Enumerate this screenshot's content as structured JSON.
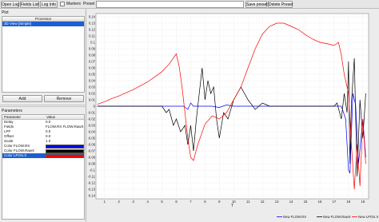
{
  "toolbar": {
    "open_log": "Open Log",
    "fields_list": "Fields List",
    "log_info": "Log Info",
    "markers_label": "Markers",
    "preset_label": "Preset",
    "save_preset": "Save preset",
    "delete_preset": "Delete Preset"
  },
  "plot_panel": {
    "title": "Plot",
    "table_header": "Processor",
    "selected_item": "3D View [Simple]",
    "add_button": "Add",
    "remove_button": "Remove"
  },
  "parameters_panel": {
    "title": "Parameters",
    "col_parameter": "Parameter",
    "col_value": "Value",
    "rows": [
      {
        "name": "Delay",
        "value": "0.0"
      },
      {
        "name": "Fields",
        "value": "FLOW.RX FLOW.RawX"
      },
      {
        "name": "LPF",
        "value": "0.0"
      },
      {
        "name": "Offset",
        "value": "0.0"
      },
      {
        "name": "Scale",
        "value": "1.0"
      }
    ],
    "color_rows": [
      {
        "name": "Color FLOW.RX",
        "color": "#0000ff"
      },
      {
        "name": "Color FLOW.RawX",
        "color": "#000000"
      },
      {
        "name": "Color LPOS.X",
        "color": "#ff0000"
      }
    ]
  },
  "chart_data": {
    "type": "line",
    "title": "",
    "xlabel": "T",
    "ylabel": "",
    "xlim": [
      0.4,
      19.4
    ],
    "ylim": [
      -0.145,
      0.145
    ],
    "grid": true,
    "legend_position": "bottom-right",
    "x_ticks": [
      "1",
      "2",
      "3",
      "4",
      "5",
      "6",
      "7",
      "8",
      "9",
      "10",
      "11",
      "12",
      "13",
      "14",
      "15",
      "16",
      "17",
      "18",
      "19"
    ],
    "y_ticks": [
      "0.14",
      "0.13",
      "0.12",
      "0.11",
      "0.1",
      "0.09",
      "0.08",
      "0.07",
      "0.06",
      "0.05",
      "0.04",
      "0.03",
      "0.02",
      "0.01",
      "0",
      "-0.01",
      "-0.02",
      "-0.03",
      "-0.04",
      "-0.05",
      "-0.06",
      "-0.07",
      "-0.08",
      "-0.09",
      "-0.1",
      "-0.11",
      "-0.12",
      "-0.13",
      "-0.14"
    ],
    "series": [
      {
        "name": "New FLOW.RX",
        "color": "#0000ff",
        "x": [
          0.5,
          1,
          2,
          3,
          4,
          5,
          5.5,
          6,
          6.5,
          6.8,
          7,
          7.2,
          7.5,
          8,
          8.5,
          9,
          9.5,
          10,
          10.5,
          11,
          11.5,
          12,
          13,
          14,
          15,
          16,
          16.5,
          17,
          17.5,
          17.8,
          18,
          18.1,
          18.3,
          18.5,
          18.7,
          19,
          19.2
        ],
        "y": [
          0,
          0,
          0,
          0,
          0,
          0,
          0,
          0,
          0,
          -0.005,
          0.005,
          0,
          0,
          0,
          0,
          -0.002,
          0.002,
          0,
          0,
          0,
          0,
          0,
          0,
          0,
          0,
          0,
          0,
          0,
          0,
          -0.02,
          -0.1,
          -0.105,
          0.02,
          0.002,
          -0.09,
          -0.02,
          -0.08
        ]
      },
      {
        "name": "New FLOW.RawX",
        "color": "#000000",
        "x": [
          0.5,
          1,
          2,
          3,
          4,
          5,
          5.3,
          5.5,
          5.8,
          6,
          6.3,
          6.6,
          6.8,
          7,
          7.2,
          7.4,
          7.6,
          7.8,
          8,
          8.2,
          8.4,
          8.6,
          8.8,
          9,
          9.3,
          9.6,
          10,
          10.5,
          11,
          11.5,
          12,
          12.5,
          13,
          13.5,
          14,
          14.5,
          15,
          15.5,
          16,
          16.5,
          17,
          17.2,
          17.5,
          17.7,
          17.9,
          18,
          18.1,
          18.2,
          18.4,
          18.6,
          18.8,
          19,
          19.2
        ],
        "y": [
          0,
          0,
          0,
          0,
          0,
          0,
          -0.01,
          -0.005,
          -0.03,
          -0.02,
          -0.04,
          -0.03,
          -0.06,
          -0.03,
          -0.07,
          -0.02,
          0.02,
          0.06,
          0.01,
          0.04,
          0.02,
          0.03,
          -0.02,
          -0.05,
          -0.01,
          -0.02,
          0.01,
          0.03,
          0.01,
          -0.005,
          0.005,
          0,
          0,
          0,
          0,
          0,
          0,
          0,
          0,
          0,
          0,
          0.005,
          -0.02,
          0.02,
          -0.01,
          0.07,
          -0.09,
          0.005,
          0.075,
          -0.11,
          0.01,
          -0.05,
          0.02
        ]
      },
      {
        "name": "New LPOS.X",
        "color": "#ff0000",
        "x": [
          0.5,
          1,
          1.5,
          2,
          2.5,
          3,
          3.5,
          4,
          4.5,
          5,
          5.5,
          6,
          6.2,
          6.4,
          6.6,
          6.8,
          7,
          7.2,
          7.5,
          8,
          8.5,
          9,
          9.5,
          10,
          10.5,
          11,
          11.5,
          12,
          12.5,
          13,
          13.5,
          14,
          14.5,
          15,
          15.5,
          16,
          16.5,
          17,
          17.3,
          17.5,
          17.7,
          18,
          18.2,
          18.4,
          18.6,
          18.8,
          19,
          19.2
        ],
        "y": [
          0.003,
          0.007,
          0.012,
          0.016,
          0.021,
          0.026,
          0.032,
          0.038,
          0.046,
          0.054,
          0.066,
          0.082,
          0.062,
          0.03,
          -0.01,
          -0.05,
          -0.08,
          -0.085,
          -0.06,
          -0.028,
          -0.015,
          -0.02,
          -0.01,
          0.01,
          0.03,
          0.06,
          0.09,
          0.113,
          0.125,
          0.13,
          0.13,
          0.125,
          0.12,
          0.112,
          0.105,
          0.1,
          0.098,
          0.095,
          0.1,
          0.08,
          0.05,
          0.02,
          -0.06,
          -0.13,
          -0.06,
          -0.125,
          -0.02,
          -0.09
        ]
      }
    ]
  }
}
